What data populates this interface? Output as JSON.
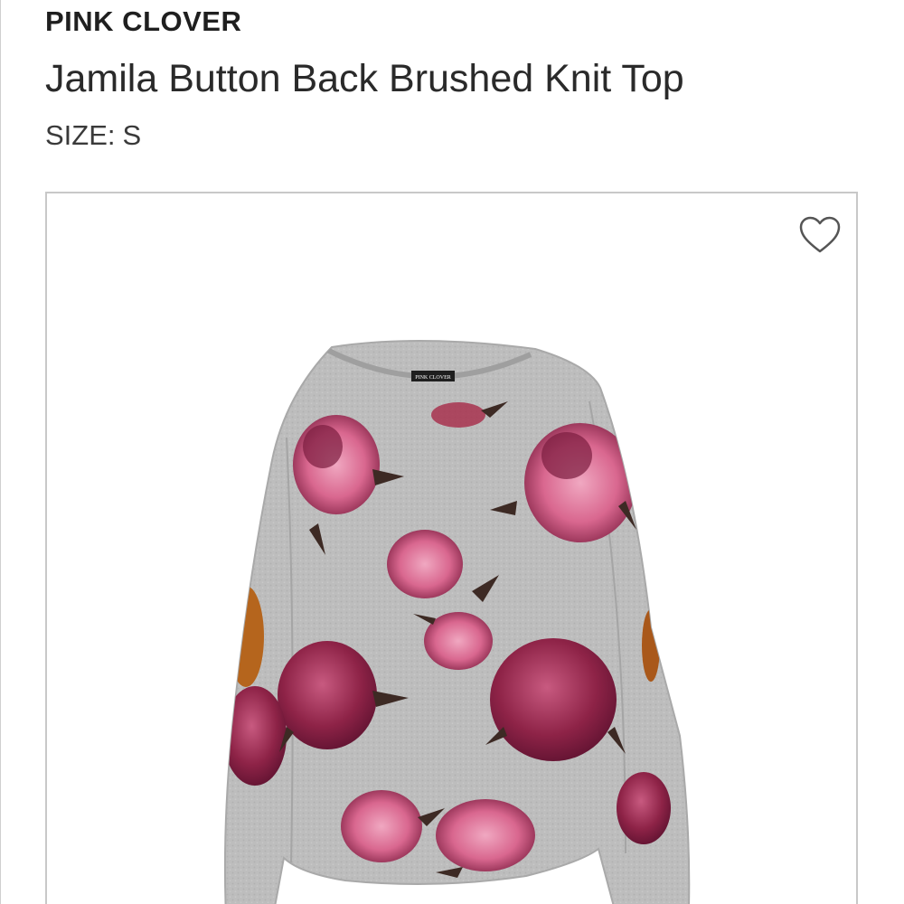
{
  "product": {
    "brand": "PINK CLOVER",
    "title": "Jamila Button Back Brushed Knit Top",
    "size_label": "SIZE:",
    "size_value": "S",
    "tag_text": "PINK CLOVER"
  },
  "colors": {
    "knit_gray": "#bdbdbd",
    "rose_dark": "#7a1d3f",
    "rose_light": "#d9678f",
    "leaf": "#3d2a24",
    "elbow_patch": "#b5651d",
    "card_border": "#c8c8c8"
  },
  "icons": {
    "favorite": "heart-outline-icon"
  }
}
